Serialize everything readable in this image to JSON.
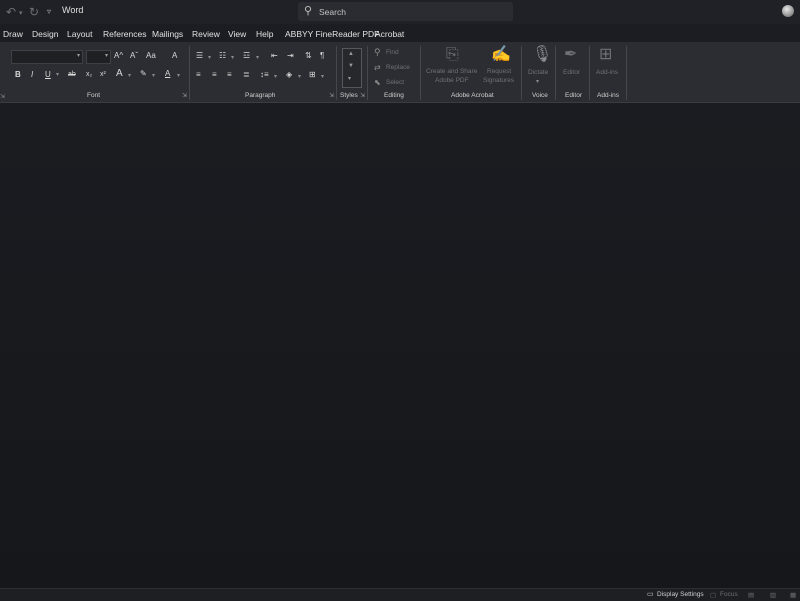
{
  "titlebar": {
    "app_title": "Word",
    "undo_icon": "undo-icon",
    "redo_icon": "redo-icon",
    "customize_icon": "customize-quick-access-icon",
    "search_placeholder": "Search"
  },
  "tabs": [
    "Draw",
    "Design",
    "Layout",
    "References",
    "Mailings",
    "Review",
    "View",
    "Help",
    "ABBYY FineReader PDF",
    "Acrobat"
  ],
  "ribbon": {
    "groups": {
      "font": "Font",
      "paragraph": "Paragraph",
      "styles": "Styles",
      "editing": "Editing",
      "adobe_acrobat": "Adobe Acrobat",
      "voice": "Voice",
      "editor": "Editor",
      "addins": "Add-ins"
    },
    "font_buttons": {
      "bold": "B",
      "italic": "I",
      "underline": "U",
      "strikethrough": "ab",
      "subscript": "x₂",
      "superscript": "x²",
      "text_effects": "A",
      "highlight": "✎",
      "font_color": "A",
      "grow": "A^",
      "shrink": "Aˇ",
      "change_case": "Aa",
      "clear_format": "A"
    },
    "paragraph_buttons": {
      "pilcrow": "¶"
    },
    "editing": {
      "find": "Find",
      "replace": "Replace",
      "select": "Select"
    },
    "acrobat": {
      "create_share_line1": "Create and Share",
      "create_share_line2": "Adobe PDF",
      "request_line1": "Request",
      "request_line2": "Signatures"
    },
    "voice": {
      "dictate": "Dictate"
    },
    "editor": {
      "editor": "Editor"
    },
    "addins": {
      "addins": "Add-ins"
    }
  },
  "statusbar": {
    "display_settings": "Display Settings",
    "focus": "Focus"
  },
  "colors": {
    "background": "#1b1d22",
    "ribbon": "#2b2d32",
    "text": "#d6d6d6",
    "disabled_text": "#6f7176"
  }
}
